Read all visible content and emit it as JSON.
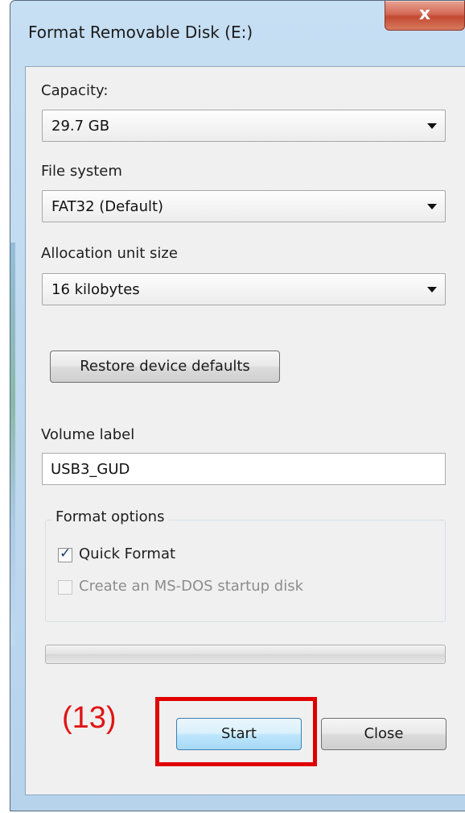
{
  "window": {
    "title": "Format Removable Disk (E:)",
    "close_glyph": "x"
  },
  "capacity": {
    "label": "Capacity:",
    "value": "29.7 GB"
  },
  "file_system": {
    "label": "File system",
    "value": "FAT32 (Default)"
  },
  "allocation": {
    "label": "Allocation unit size",
    "value": "16 kilobytes"
  },
  "restore_button": "Restore device defaults",
  "volume": {
    "label": "Volume label",
    "value": "USB3_GUD"
  },
  "format_options": {
    "legend": "Format options",
    "quick_format": {
      "label": "Quick Format",
      "checked": true
    },
    "msdos": {
      "label": "Create an MS-DOS startup disk",
      "checked": false,
      "disabled": true
    }
  },
  "progress": {
    "value": 0
  },
  "buttons": {
    "start": "Start",
    "close": "Close"
  },
  "annotation": {
    "step": "(13)",
    "color": "#e00000"
  },
  "icons": {
    "dropdown": "chevron-down-icon",
    "check": "check-icon"
  }
}
